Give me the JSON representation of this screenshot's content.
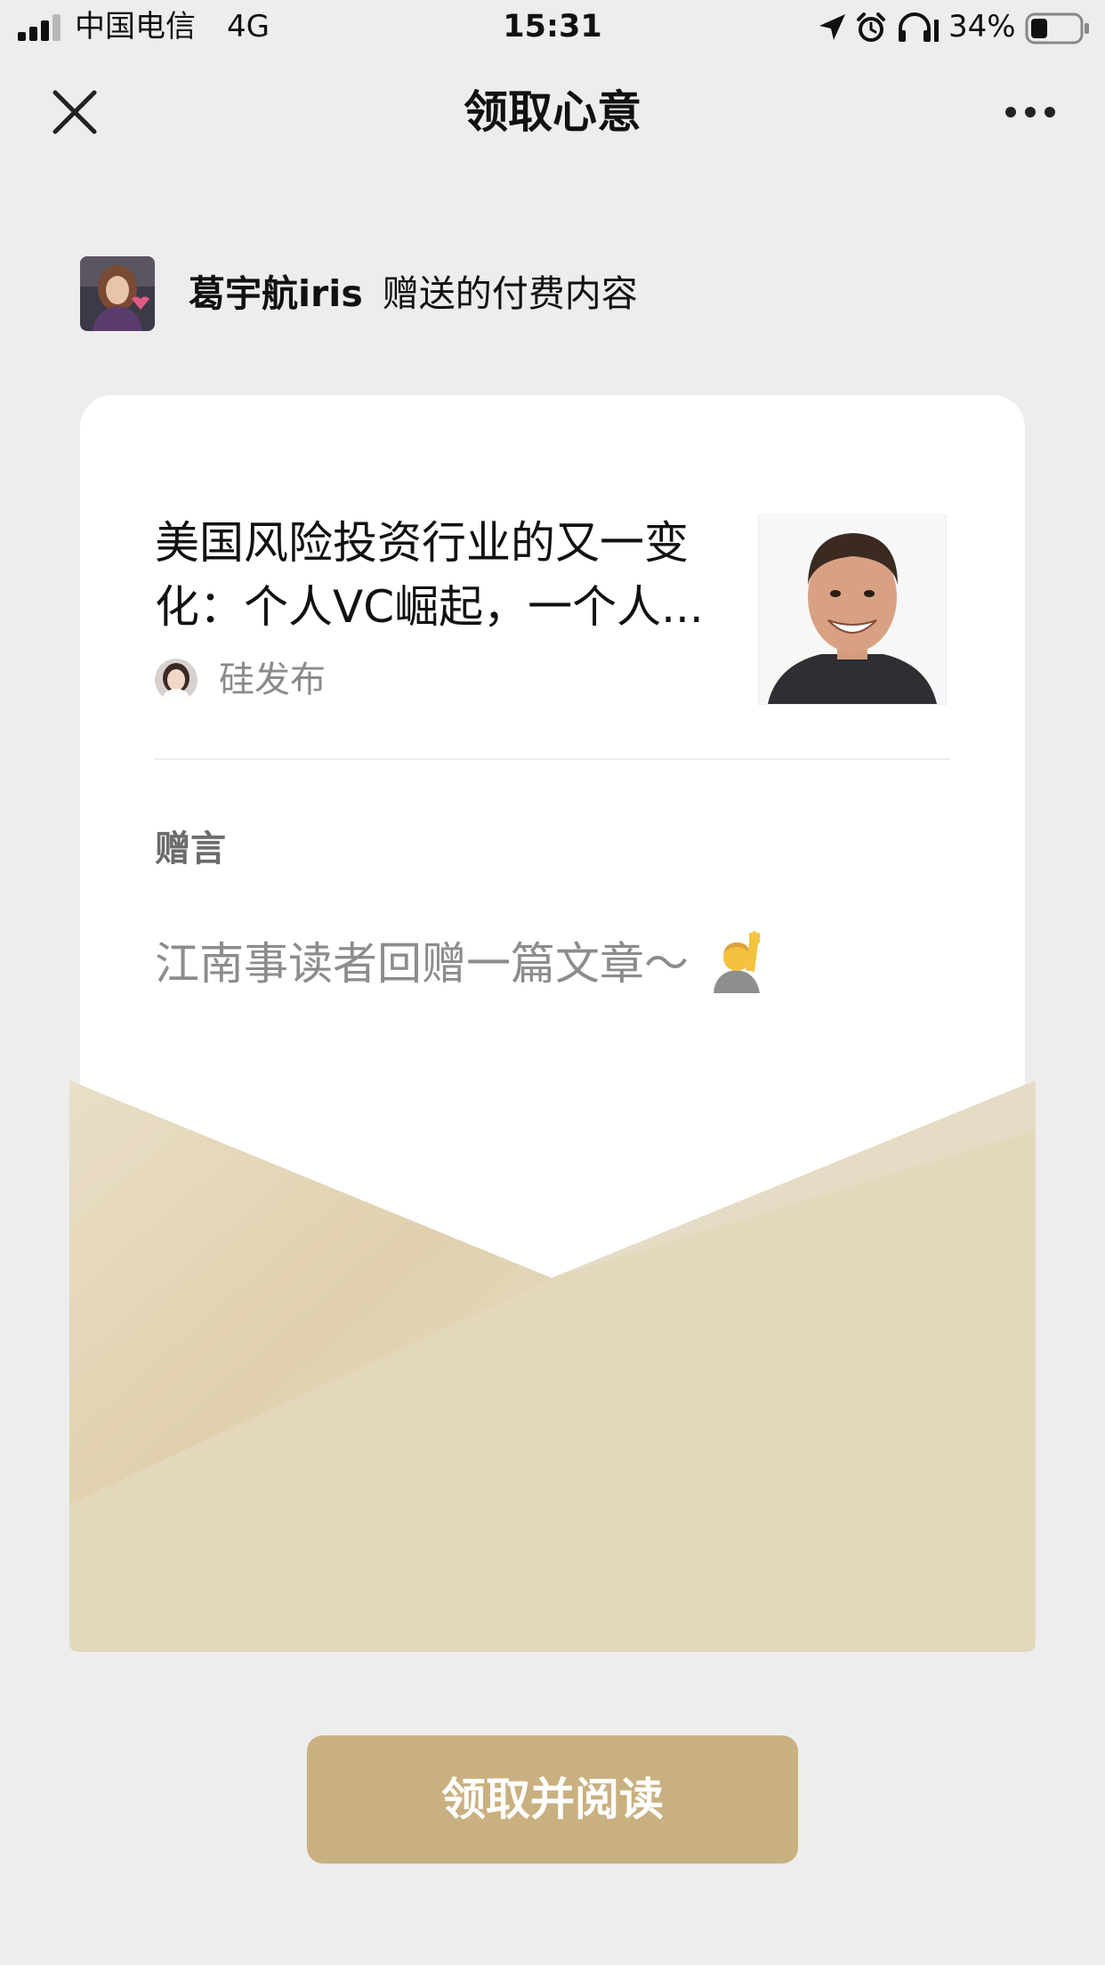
{
  "status_bar": {
    "carrier": "中国电信",
    "network": "4G",
    "time": "15:31",
    "battery_percent": "34%",
    "battery_level": 0.34
  },
  "nav": {
    "title": "领取心意",
    "left_icon": "close-icon",
    "right_icon": "more-icon"
  },
  "sender": {
    "name": "葛宇航iris",
    "suffix": "赠送的付费内容"
  },
  "article": {
    "title": "美国风险投资行业的又一变化：个人VC崛起，一个人...",
    "account_name": "硅发布"
  },
  "gift_message": {
    "label": "赠言",
    "text": "江南事读者回赠一篇文章～",
    "emoji_icon": "raising-hand-icon"
  },
  "action": {
    "claim_label": "领取并阅读"
  },
  "colors": {
    "background": "#ededed",
    "card": "#ffffff",
    "envelope": "#e3d7bc",
    "button": "#c9b080",
    "button_text": "#ffffff"
  }
}
